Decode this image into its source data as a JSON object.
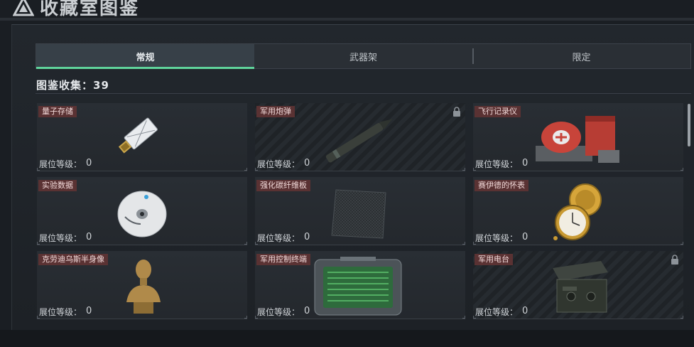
{
  "window": {
    "title": "收藏室图鉴"
  },
  "tabs": [
    {
      "label": "常规",
      "active": true
    },
    {
      "label": "武器架",
      "active": false
    },
    {
      "label": "限定",
      "active": false
    }
  ],
  "collection": {
    "label": "图鉴收集：39"
  },
  "level_label": "展位等级：",
  "items": [
    {
      "name": "量子存储",
      "level": "0",
      "locked": false,
      "icon": "usb-drive-icon"
    },
    {
      "name": "军用炮弹",
      "level": "0",
      "locked": true,
      "icon": "artillery-shell-icon"
    },
    {
      "name": "飞行记录仪",
      "level": "0",
      "locked": false,
      "icon": "flight-recorder-icon"
    },
    {
      "name": "实验数据",
      "level": "0",
      "locked": false,
      "icon": "data-disc-icon"
    },
    {
      "name": "强化碳纤维板",
      "level": "0",
      "locked": false,
      "icon": "carbon-fiber-plate-icon"
    },
    {
      "name": "赛伊德的怀表",
      "level": "0",
      "locked": false,
      "icon": "pocket-watch-icon"
    },
    {
      "name": "克劳迪乌斯半身像",
      "level": "0",
      "locked": false,
      "icon": "bust-statue-icon"
    },
    {
      "name": "军用控制终端",
      "level": "0",
      "locked": false,
      "icon": "control-terminal-icon"
    },
    {
      "name": "军用电台",
      "level": "0",
      "locked": true,
      "icon": "military-radio-icon"
    }
  ],
  "colors": {
    "accent": "#5fd39b",
    "name_tag_bg": "#5a3233",
    "panel_bg": "#22272d"
  }
}
